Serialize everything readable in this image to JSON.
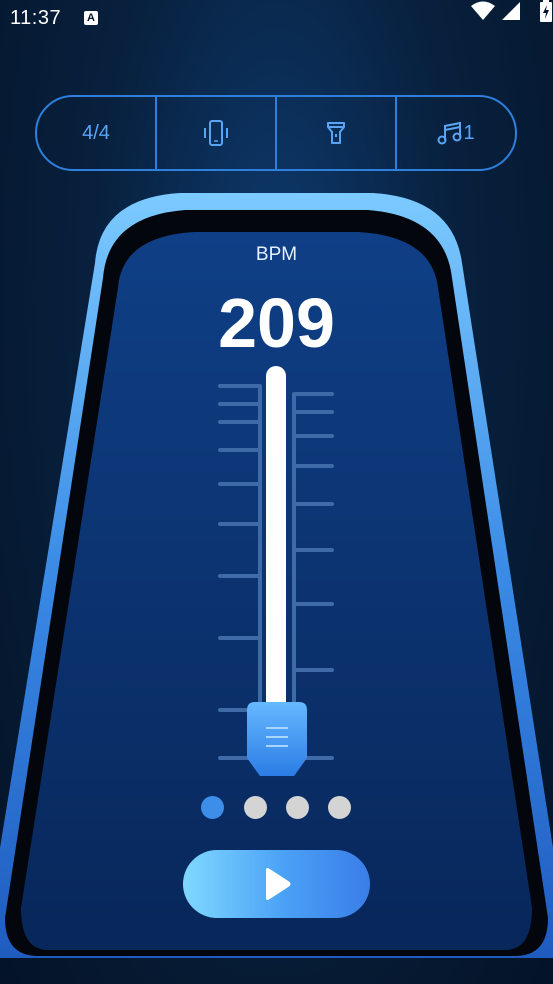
{
  "status_bar": {
    "time": "11:37",
    "notification_icon": "a-icon",
    "icons": [
      "wifi-icon",
      "signal-icon",
      "battery-icon"
    ]
  },
  "toolbar": {
    "time_signature": "4/4",
    "vibrate_icon": "vibrate-icon",
    "flashlight_icon": "flashlight-icon",
    "sound": "1",
    "sound_icon": "music-note-icon"
  },
  "metronome": {
    "bpm_label": "BPM",
    "bpm_value": "209",
    "slider_level": 0.0
  },
  "pagination": {
    "count": 4,
    "active_index": 0
  },
  "controls": {
    "play_icon": "play-icon"
  },
  "colors": {
    "accent": "#4aa0f5",
    "frame": "#5ab4f7",
    "panel": "#0f3f86",
    "active_dot": "#3d8ee8",
    "inactive_dot": "#d4d4d4"
  }
}
